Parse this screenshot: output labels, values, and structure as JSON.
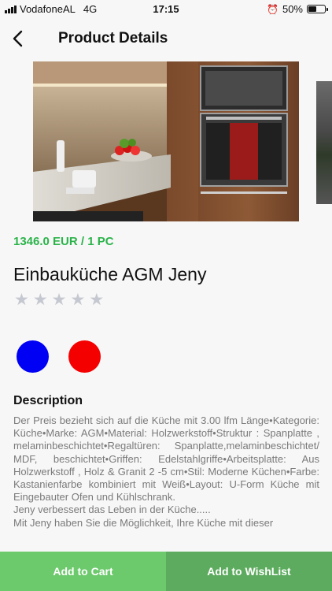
{
  "status_bar": {
    "carrier": "VodafoneAL",
    "network": "4G",
    "time": "17:15",
    "battery": "50%",
    "battery_level": 0.5
  },
  "header": {
    "title": "Product Details",
    "back_icon": "chevron-left-icon"
  },
  "gallery": {
    "image_label": "kitchen-photo"
  },
  "product": {
    "price": "1346.0 EUR / 1 PC",
    "name": "Einbauküche AGM Jeny",
    "rating": 0,
    "rating_max": 5,
    "colors": [
      "#0000f5",
      "#f50000"
    ]
  },
  "description": {
    "title": "Description",
    "paragraphs": [
      "Der Preis bezieht sich auf die Küche mit 3.00 lfm Länge•Kategorie: Küche•Marke: AGM•Material: Holzwerkstoff•Struktur : Spanplatte , melaminbeschichtet•Regaltüren: Spanplatte,melaminbeschichtet/ MDF, beschichtet•Griffen: Edelstahlgriffe•Arbeitsplatte: Aus Holzwerkstoff , Holz & Granit 2 -5 cm•Stil: Moderne Küchen•Farbe: Kastanienfarbe kombiniert mit Weiß•Layout: U-Form Küche mit Eingebauter Ofen und Kühlschrank.",
      "Jeny verbessert das Leben in der Küche.....",
      "Mit Jeny haben Sie die Möglichkeit, Ihre Küche mit dieser"
    ]
  },
  "actions": {
    "add_to_cart": "Add to Cart",
    "add_to_wishlist": "Add to WishList"
  }
}
